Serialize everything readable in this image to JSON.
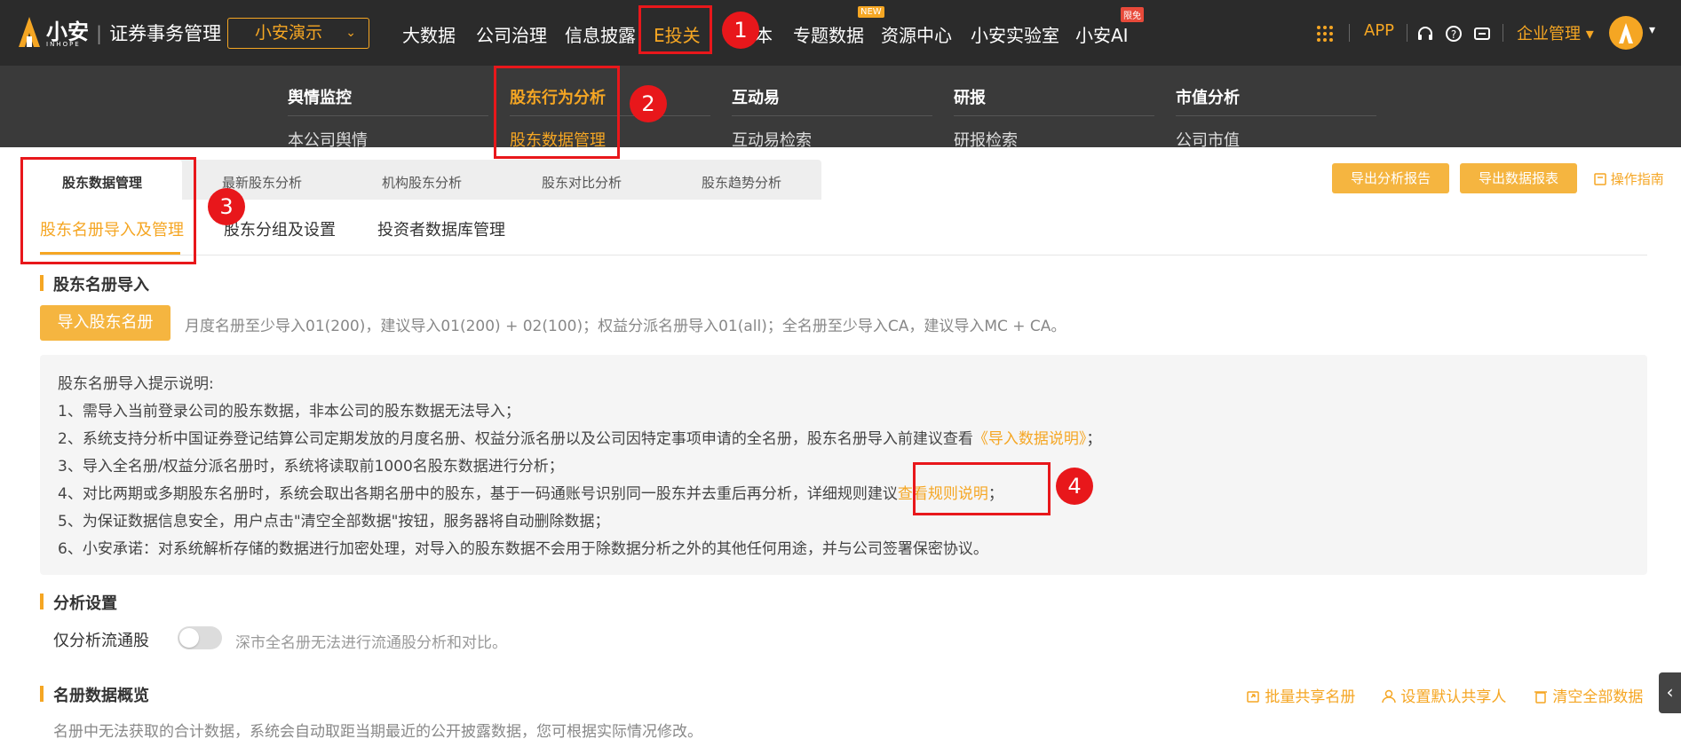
{
  "header": {
    "brand": "小安",
    "brand_sub": "INHOPE",
    "app_title": "证券事务管理",
    "demo_select": "小安演示",
    "nav": [
      "大数据",
      "公司治理",
      "信息披露",
      "E投关",
      "资本",
      "专题数据",
      "资源中心",
      "小安实验室",
      "小安AI"
    ],
    "nav_badge_new": "NEW",
    "nav_badge_free": "限免",
    "app_label": "APP",
    "enterprise_label": "企业管理"
  },
  "mega_menu": {
    "cols": [
      {
        "head": "舆情监控",
        "sub": "本公司舆情"
      },
      {
        "head": "股东行为分析",
        "sub": "股东数据管理"
      },
      {
        "head": "互动易",
        "sub": "互动易检索"
      },
      {
        "head": "研报",
        "sub": "研报检索"
      },
      {
        "head": "市值分析",
        "sub": "公司市值"
      }
    ]
  },
  "tabs": [
    "股东数据管理",
    "最新股东分析",
    "机构股东分析",
    "股东对比分析",
    "股东趋势分析"
  ],
  "actions": {
    "export_report": "导出分析报告",
    "export_data": "导出数据报表",
    "guide": "操作指南"
  },
  "subtabs": [
    "股东名册导入及管理",
    "股东分组及设置",
    "投资者数据库管理"
  ],
  "import_section": {
    "title": "股东名册导入",
    "button": "导入股东名册",
    "hint": "月度名册至少导入01(200)，建议导入01(200) + 02(100)；权益分派名册导入01(all)；全名册至少导入CA，建议导入MC + CA。",
    "info_title": "股东名册导入提示说明:",
    "line1": "1、需导入当前登录公司的股东数据，非本公司的股东数据无法导入；",
    "line2_pre": "2、系统支持分析中国证券登记结算公司定期发放的月度名册、权益分派名册以及公司因特定事项申请的全名册，股东名册导入前建议查看",
    "line2_link": "《导入数据说明》",
    "line2_post": "；",
    "line3": "3、导入全名册/权益分派名册时，系统将读取前1000名股东数据进行分析；",
    "line4_pre": "4、对比两期或多期股东名册时，系统会取出各期名册中的股东，基于一码通账号识别同一股东并去重后再分析，详细规则建议",
    "line4_link": "查看规则说明",
    "line4_post": "；",
    "line5": "5、为保证数据信息安全，用户点击\"清空全部数据\"按钮，服务器将自动删除数据；",
    "line6": "6、小安承诺：对系统解析存储的数据进行加密处理，对导入的股东数据不会用于除数据分析之外的其他任何用途，并与公司签署保密协议。"
  },
  "analysis_section": {
    "title": "分析设置",
    "toggle_label": "仅分析流通股",
    "toggle_hint": "深市全名册无法进行流通股分析和对比。"
  },
  "overview_section": {
    "title": "名册数据概览",
    "share": "批量共享名册",
    "default_share": "设置默认共享人",
    "clear": "清空全部数据",
    "note": "名册中无法获取的合计数据，系统会自动取距当期最近的公开披露数据，您可根据实际情况修改。"
  },
  "annotations": [
    "1",
    "2",
    "3",
    "4"
  ],
  "colors": {
    "accent": "#f5a623",
    "annotation": "#e8171b",
    "nav_bg": "#2b2b2b"
  }
}
